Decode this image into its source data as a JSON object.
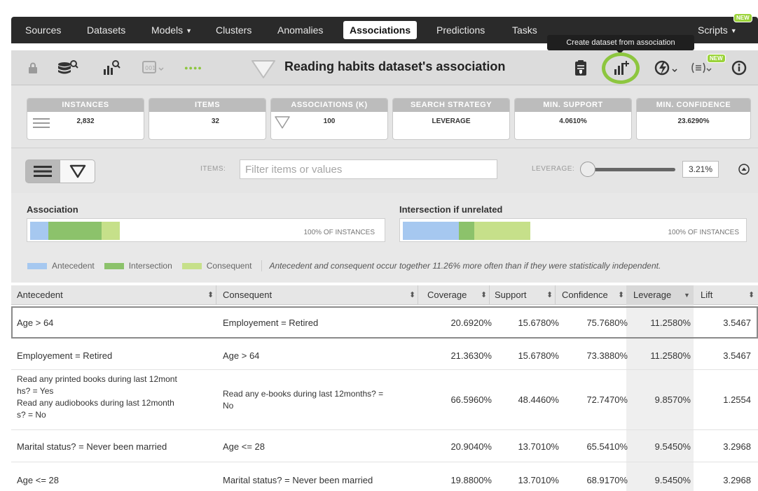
{
  "nav": {
    "items": [
      {
        "label": "Sources",
        "caret": false,
        "active": false
      },
      {
        "label": "Datasets",
        "caret": false,
        "active": false
      },
      {
        "label": "Models",
        "caret": true,
        "active": false
      },
      {
        "label": "Clusters",
        "caret": false,
        "active": false
      },
      {
        "label": "Anomalies",
        "caret": false,
        "active": false
      },
      {
        "label": "Associations",
        "caret": false,
        "active": true
      },
      {
        "label": "Predictions",
        "caret": false,
        "active": false
      },
      {
        "label": "Tasks",
        "caret": false,
        "active": false
      }
    ],
    "scripts_label": "Scripts",
    "new_badge": "NEW"
  },
  "toolbar": {
    "title": "Reading habits dataset's association",
    "dots": "●●●●",
    "tooltip": "Create dataset from association",
    "new_badge": "NEW",
    "accent_color": "#8dc63f"
  },
  "stats": [
    {
      "label": "INSTANCES",
      "value": "2,832"
    },
    {
      "label": "ITEMS",
      "value": "32"
    },
    {
      "label": "ASSOCIATIONS (K)",
      "value": "100"
    },
    {
      "label": "SEARCH STRATEGY",
      "value": "LEVERAGE"
    },
    {
      "label": "MIN. SUPPORT",
      "value": "4.0610%"
    },
    {
      "label": "MIN. CONFIDENCE",
      "value": "23.6290%"
    }
  ],
  "controls": {
    "items_label": "ITEMS:",
    "filter_placeholder": "Filter items or values",
    "leverage_label": "LEVERAGE:",
    "leverage_value": "3.21%"
  },
  "bars": {
    "association_title": "Association",
    "intersection_title": "Intersection if unrelated",
    "association_note": "100% OF INSTANCES",
    "intersection_note": "100% OF INSTANCES",
    "colors": {
      "antecedent": "#a6c8f0",
      "intersection": "#8cc26b",
      "consequent": "#c6e08a"
    }
  },
  "legend": {
    "antecedent": "Antecedent",
    "intersection": "Intersection",
    "consequent": "Consequent",
    "note": "Antecedent and consequent occur together 11.26% more often than if they were statistically independent."
  },
  "table": {
    "columns": [
      "Antecedent",
      "Consequent",
      "Coverage",
      "Support",
      "Confidence",
      "Leverage",
      "Lift"
    ],
    "rows": [
      {
        "antecedent": "Age > 64",
        "consequent": "Employement = Retired",
        "coverage": "20.6920%",
        "support": "15.6780%",
        "confidence": "75.7680%",
        "leverage": "11.2580%",
        "lift": "3.5467"
      },
      {
        "antecedent": "Employement = Retired",
        "consequent": "Age > 64",
        "coverage": "21.3630%",
        "support": "15.6780%",
        "confidence": "73.3880%",
        "leverage": "11.2580%",
        "lift": "3.5467"
      },
      {
        "antecedent": "Read any printed books during last 12mont\nhs? = Yes\nRead any audiobooks during last 12month\ns? = No",
        "consequent": "Read any e-books during last 12months? =\nNo",
        "coverage": "66.5960%",
        "support": "48.4460%",
        "confidence": "72.7470%",
        "leverage": "9.8570%",
        "lift": "1.2554"
      },
      {
        "antecedent": "Marital status? = Never been married",
        "consequent": "Age <= 28",
        "coverage": "20.9040%",
        "support": "13.7010%",
        "confidence": "65.5410%",
        "leverage": "9.5450%",
        "lift": "3.2968"
      },
      {
        "antecedent": "Age <= 28",
        "consequent": "Marital status? = Never been married",
        "coverage": "19.8800%",
        "support": "13.7010%",
        "confidence": "68.9170%",
        "leverage": "9.5450%",
        "lift": "3.2968"
      }
    ]
  }
}
